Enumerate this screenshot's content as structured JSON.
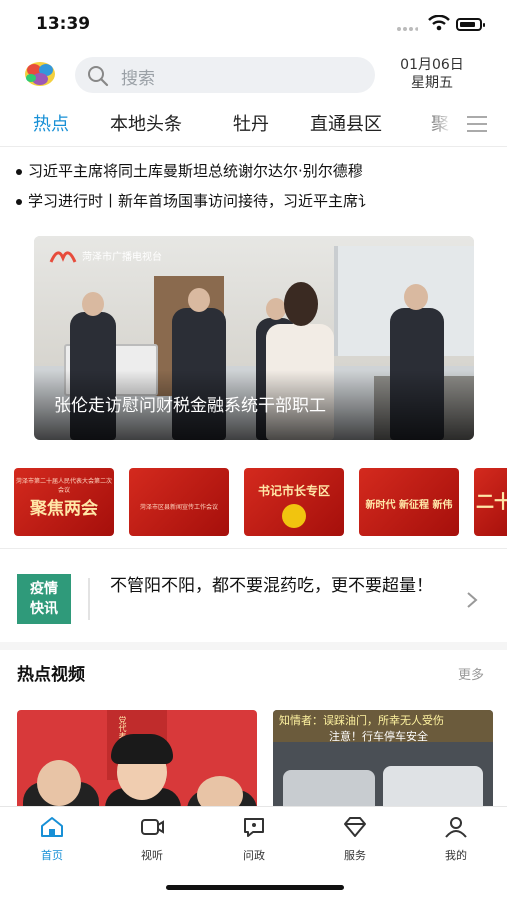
{
  "status": {
    "time": "13:39"
  },
  "header": {
    "search_placeholder": "搜索",
    "date": "01月06日",
    "weekday": "星期五"
  },
  "tabs": [
    {
      "label": "热点",
      "active": true
    },
    {
      "label": "本地头条"
    },
    {
      "label": "牡丹"
    },
    {
      "label": "直通县区"
    },
    {
      "label": "聚"
    }
  ],
  "ticker": [
    "习近平主席将同土库曼斯坦总统谢尔达尔·别尔德穆",
    "学习进行时丨新年首场国事访问接待，习近平主席讠"
  ],
  "banner": {
    "caption": "张伦走访慰问财税金融系统干部职工",
    "watermark": "菏泽市广播电视台"
  },
  "cards": [
    {
      "title": "聚焦两会",
      "sub": "菏泽市第二十届人民代表大会第二次会议"
    },
    {
      "title": "",
      "sub": "菏泽市区县新闻宣传工作会议"
    },
    {
      "title": "书记市长专区",
      "sub": ""
    },
    {
      "title": "新时代 新征程 新伟",
      "sub": ""
    },
    {
      "title": "二十",
      "sub": ""
    }
  ],
  "flash": {
    "badge_line1": "疫情",
    "badge_line2": "快讯",
    "text": "不管阳不阳，都不要混药吃，更不要超量！"
  },
  "section": {
    "title": "热点视频",
    "more": "更多"
  },
  "videos": [
    {
      "overlay": "党代表 市长 代表"
    },
    {
      "line1": "知情者：误踩油门，所幸无人受伤",
      "line2": "注意！行车停车安全"
    }
  ],
  "tabbar": [
    {
      "label": "首页",
      "icon": "home-icon",
      "active": true
    },
    {
      "label": "视听",
      "icon": "video-icon"
    },
    {
      "label": "问政",
      "icon": "chat-icon"
    },
    {
      "label": "服务",
      "icon": "service-icon"
    },
    {
      "label": "我的",
      "icon": "user-icon"
    }
  ],
  "colors": {
    "accent": "#1890d6",
    "flash_badge": "#2f9a7a",
    "card_red": "#c4201a"
  }
}
